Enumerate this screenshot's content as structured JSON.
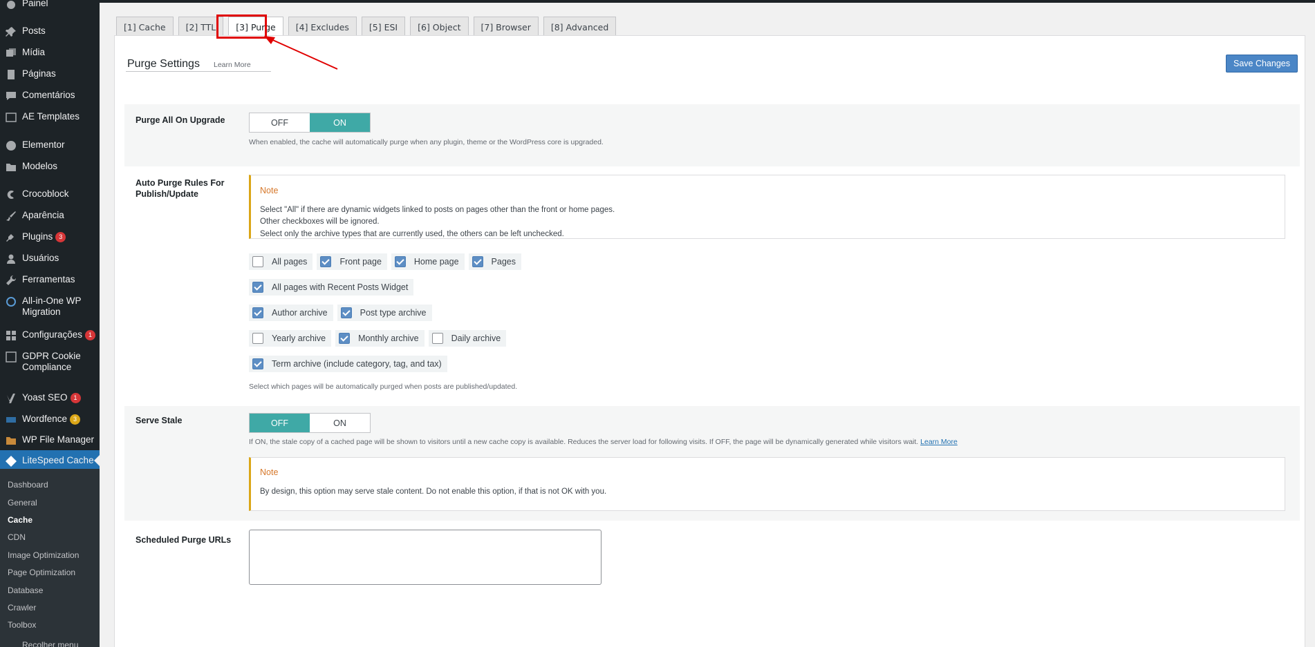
{
  "sidebar": {
    "items": [
      {
        "label": "Painel",
        "icon": "dashboard-icon"
      },
      {
        "label": "Posts",
        "icon": "pin-icon"
      },
      {
        "label": "Mídia",
        "icon": "media-icon"
      },
      {
        "label": "Páginas",
        "icon": "pages-icon"
      },
      {
        "label": "Comentários",
        "icon": "comments-icon"
      },
      {
        "label": "AE Templates",
        "icon": "ae-icon"
      },
      {
        "label": "Elementor",
        "icon": "elementor-icon"
      },
      {
        "label": "Modelos",
        "icon": "folder-icon"
      },
      {
        "label": "Crocoblock",
        "icon": "crocoblock-icon"
      },
      {
        "label": "Aparência",
        "icon": "brush-icon"
      },
      {
        "label": "Plugins",
        "icon": "plugin-icon",
        "badge": "3"
      },
      {
        "label": "Usuários",
        "icon": "user-icon"
      },
      {
        "label": "Ferramentas",
        "icon": "wrench-icon"
      },
      {
        "label": "All-in-One WP Migration",
        "icon": "migration-icon"
      },
      {
        "label": "Configurações",
        "icon": "settings-icon",
        "badge": "1"
      },
      {
        "label": "GDPR Cookie Compliance",
        "icon": "cookie-icon"
      },
      {
        "label": "Yoast SEO",
        "icon": "yoast-icon",
        "badge": "1"
      },
      {
        "label": "Wordfence",
        "icon": "wordfence-icon",
        "badge": "3"
      },
      {
        "label": "WP File Manager",
        "icon": "file-manager-icon"
      },
      {
        "label": "LiteSpeed Cache",
        "icon": "litespeed-icon"
      }
    ],
    "submenu": [
      "Dashboard",
      "General",
      "Cache",
      "CDN",
      "Image Optimization",
      "Page Optimization",
      "Database",
      "Crawler",
      "Toolbox",
      "Recolher menu"
    ]
  },
  "tabs": [
    "[1] Cache",
    "[2] TTL",
    "[3] Purge",
    "[4] Excludes",
    "[5] ESI",
    "[6] Object",
    "[7] Browser",
    "[8] Advanced"
  ],
  "header": {
    "title": "Purge Settings",
    "learn_more": "Learn More",
    "save": "Save Changes"
  },
  "purge_upgrade": {
    "label": "Purge All On Upgrade",
    "off": "OFF",
    "on": "ON",
    "state": "ON",
    "desc": "When enabled, the cache will automatically purge when any plugin, theme or the WordPress core is upgraded."
  },
  "auto_purge": {
    "label": "Auto Purge Rules For Publish/Update",
    "note_title": "Note",
    "note_lines": [
      "Select \"All\" if there are dynamic widgets linked to posts on pages other than the front or home pages.",
      "Other checkboxes will be ignored.",
      "Select only the archive types that are currently used, the others can be left unchecked."
    ],
    "checkbox_rows": [
      [
        {
          "label": "All pages",
          "checked": false
        },
        {
          "label": "Front page",
          "checked": true
        },
        {
          "label": "Home page",
          "checked": true
        },
        {
          "label": "Pages",
          "checked": true
        }
      ],
      [
        {
          "label": "All pages with Recent Posts Widget",
          "checked": true
        }
      ],
      [
        {
          "label": "Author archive",
          "checked": true
        },
        {
          "label": "Post type archive",
          "checked": true
        }
      ],
      [
        {
          "label": "Yearly archive",
          "checked": false
        },
        {
          "label": "Monthly archive",
          "checked": true
        },
        {
          "label": "Daily archive",
          "checked": false
        }
      ],
      [
        {
          "label": "Term archive (include category, tag, and tax)",
          "checked": true
        }
      ]
    ],
    "desc": "Select which pages will be automatically purged when posts are published/updated."
  },
  "serve_stale": {
    "label": "Serve Stale",
    "off": "OFF",
    "on": "ON",
    "state": "OFF",
    "desc": "If ON, the stale copy of a cached page will be shown to visitors until a new cache copy is available. Reduces the server load for following visits. If OFF, the page will be dynamically generated while visitors wait.",
    "learn_more": "Learn More",
    "note_title": "Note",
    "note_text": "By design, this option may serve stale content. Do not enable this option, if that is not OK with you."
  },
  "scheduled": {
    "label": "Scheduled Purge URLs",
    "value": ""
  },
  "colors": {
    "accent": "#3fa9a6",
    "sidebar_bg": "#1d2327",
    "current": "#2271b1",
    "save": "#4b86c6",
    "highlight": "#e00000"
  }
}
